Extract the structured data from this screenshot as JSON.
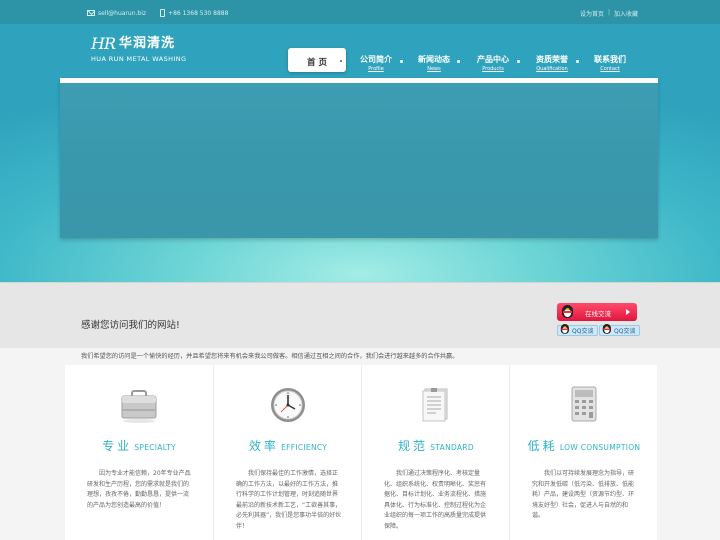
{
  "topbar": {
    "email": "sell@huarun.biz",
    "phone": "+86 1368 530 8888",
    "set_home": "设为首页",
    "separator": "|",
    "add_favorite": "加入收藏"
  },
  "logo": {
    "mark": "HR",
    "name_cn": "华润清洗",
    "name_en": "HUA RUN METAL WASHING"
  },
  "nav": {
    "items": [
      {
        "zh": "首 页",
        "en": ""
      },
      {
        "zh": "公司简介",
        "en": "Profile"
      },
      {
        "zh": "新闻动态",
        "en": "News"
      },
      {
        "zh": "产品中心",
        "en": "Products"
      },
      {
        "zh": "资质荣誉",
        "en": "Qualification"
      },
      {
        "zh": "联系我们",
        "en": "Contact"
      }
    ]
  },
  "welcome": {
    "title": "感谢您访问我们的网站!",
    "online_chat": "在线交流",
    "qq1": "QQ交谈",
    "qq2": "QQ交谈",
    "intro": "我们希望您的访问是一个愉快的经历，并且希望您将来有机会来我公司做客。相信通过互相之间的合作，我们会进行越来越多的合作共赢。"
  },
  "features": [
    {
      "icon": "briefcase-icon",
      "title_zh": "专业",
      "title_en": "Specialty",
      "desc": "因为专业才能信赖，20年专业产品研发和生产历程，您的需求就是我们的理想，孜孜不倦，勤勤恳恳，提供一流的产品为您创造最高的价值！"
    },
    {
      "icon": "clock-icon",
      "title_zh": "效率",
      "title_en": "Efficiency",
      "desc": "我们保持最佳的工作激情，选择正确的工作方法，以最好的工作方法，推行科学的工作计划管理，时刻追随世界最前沿的新技术新工艺，“工欲善其事，必先利其器”，我们是您事功半倍的好伙伴！"
    },
    {
      "icon": "document-icon",
      "title_zh": "规范",
      "title_en": "Standard",
      "desc": "我们通过决策程序化、考核定量化、组织系统化、权责明晰化、奖惩有据化、目标计划化、业务流程化、措施具体化、行为标准化、控制过程化为企业组织的每一项工作的高质量完成提供保障。"
    },
    {
      "icon": "calculator-icon",
      "title_zh": "低耗",
      "title_en": "Low Consumption",
      "desc": "我们以可持续发展理念为指导，研究和开发低碳（低污染、低排放、低能耗）产品，建设两型（资源节约型、环境友好型）社会，促进人与自然的和谐。"
    }
  ],
  "colors": {
    "accent": "#2fb2c9",
    "topbar": "#2d93a6",
    "chat_button": "#e0163d"
  }
}
